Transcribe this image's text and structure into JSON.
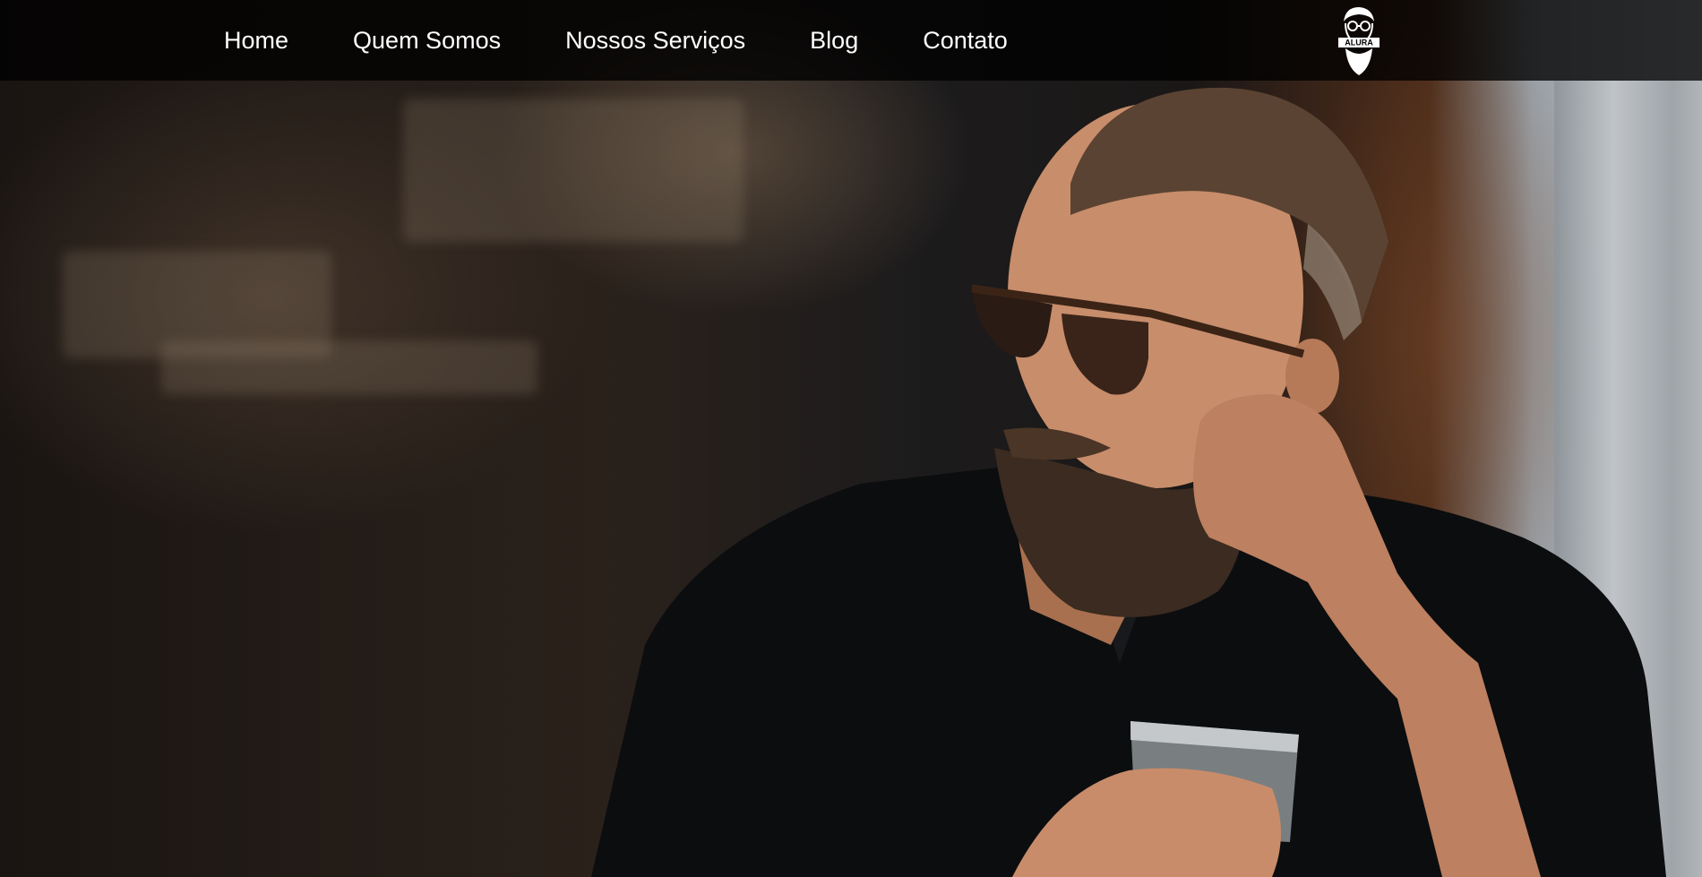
{
  "nav": {
    "items": [
      {
        "label": "Home"
      },
      {
        "label": "Quem Somos"
      },
      {
        "label": "Nossos Serviços"
      },
      {
        "label": "Blog"
      },
      {
        "label": "Contato"
      }
    ]
  },
  "logo": {
    "text": "ALURA",
    "icon": "bearded-man-logo-icon"
  },
  "hero": {
    "image": "hero-bearded-man-photo"
  },
  "colors": {
    "navbar_bg": "#000000",
    "nav_text": "#ffffff"
  }
}
